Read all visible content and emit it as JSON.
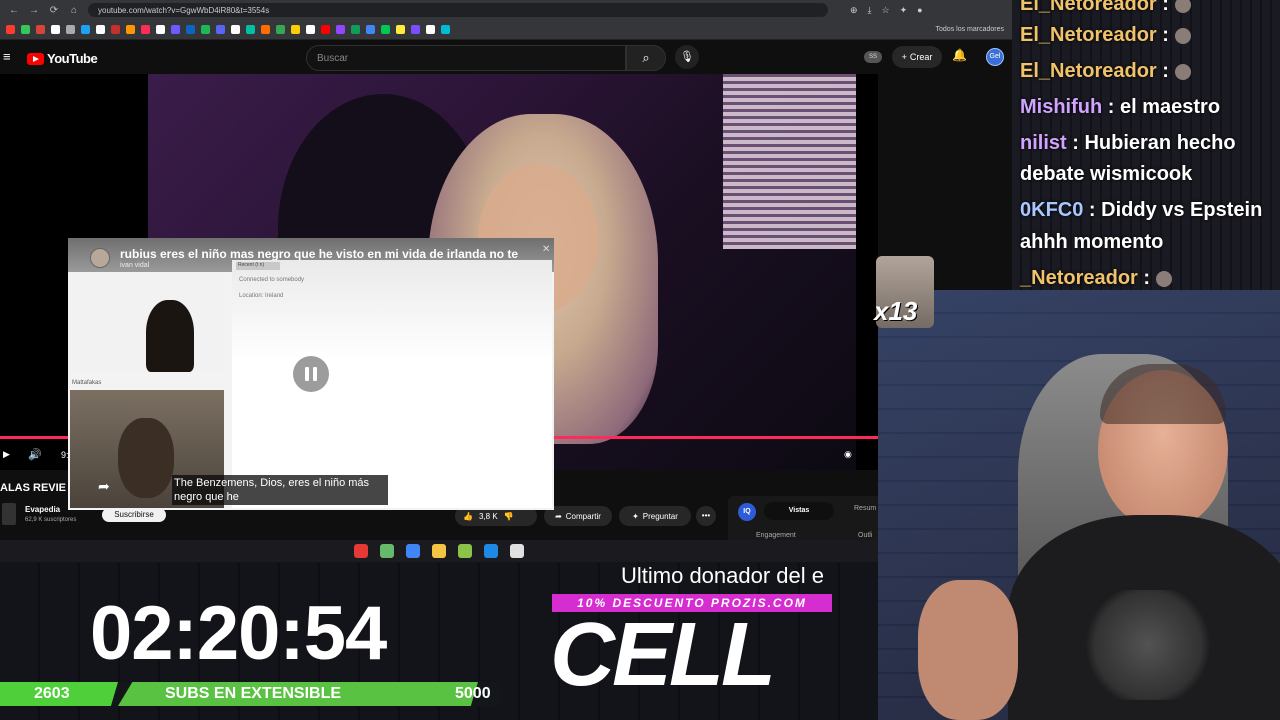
{
  "browser": {
    "url": "youtube.com/watch?v=GgwWbD4iR80&t=3554s",
    "all_bookmarks": "Todos los marcadores",
    "bookmark_colors": [
      "#ff3b30",
      "#34c759",
      "#d44638",
      "#ffffff",
      "#aaaaaa",
      "#1da1f2",
      "#ffffff",
      "#c4302b",
      "#ff9500",
      "#ff2d55",
      "#ffffff",
      "#6e5bff",
      "#0a66c2",
      "#1db954",
      "#5865f2",
      "#ffffff",
      "#00bfa5",
      "#ff6d00",
      "#34a853",
      "#ffcc00",
      "#ffffff",
      "#ff0000",
      "#9146ff",
      "#0f9d58",
      "#4285f4",
      "#00c853",
      "#ffeb3b",
      "#7c4dff",
      "#ffffff",
      "#00bcd4"
    ]
  },
  "youtube": {
    "logo_text": "YouTube",
    "search_placeholder": "Buscar",
    "badge": "SS",
    "create_label": "Crear",
    "avatar_text": "Gel",
    "video_time": "9:"
  },
  "overlay": {
    "title": "rubius eres el niño mas negro que he visto en mi vida de irlanda no te",
    "author": "ivan vidal",
    "chat_tag": "Recent (t n)",
    "chat_line1": "Connected to somebody",
    "chat_line2": "Location: Ireland",
    "cam_label": "Mattafakas",
    "subtitle": "The Benzemens, Dios, eres el niño más negro que he"
  },
  "video_info": {
    "title_cut": "ALAS REVIE",
    "channel": "Evapedia",
    "subs": "62,9 K suscriptores",
    "subscribe": "Suscribirse",
    "likes": "3,8 K",
    "share": "Compartir",
    "ask": "Preguntar",
    "more": "•••",
    "iq_logo": "IQ",
    "iq_tab_views": "Vistas",
    "iq_tab_summary": "Resum",
    "iq_engagement": "Engagement",
    "iq_outline": "Outli"
  },
  "taskbar": {
    "icons": [
      "#e53935",
      "#66bb6a",
      "#4285f4",
      "#f4c542",
      "#8bc34a",
      "#1e88e5",
      "#e0e0e0"
    ]
  },
  "stream": {
    "timer": "02:20:54",
    "subs_current": "2603",
    "subs_label": "SUBS EN EXTENSIBLE",
    "subs_goal": "5000",
    "donor_title": "Ultimo donador del e",
    "promo": "10% DESCUENTO PROZIS.COM",
    "donor_name": "CELL",
    "sticker_text": "x13"
  },
  "chat": [
    {
      "user": "El_Netoreador",
      "msg": "",
      "color": "orange"
    },
    {
      "user": "El_Netoreador",
      "msg": "",
      "color": "orange"
    },
    {
      "user": "El_Netoreador",
      "msg": "",
      "color": "orange"
    },
    {
      "user": "Mishifuh",
      "msg": "el maestro",
      "color": "purple"
    },
    {
      "user": "nilist",
      "msg": "Hubieran hecho",
      "color": "purple"
    },
    {
      "user": "",
      "msg": "debate wismicook",
      "color": "white"
    },
    {
      "user": "0KFC0",
      "msg": "Diddy vs Epstein",
      "color": "blue"
    },
    {
      "user": "",
      "msg": "ahhh momento",
      "color": "white"
    },
    {
      "user": "_Netoreador",
      "msg": "",
      "color": "orange"
    }
  ]
}
